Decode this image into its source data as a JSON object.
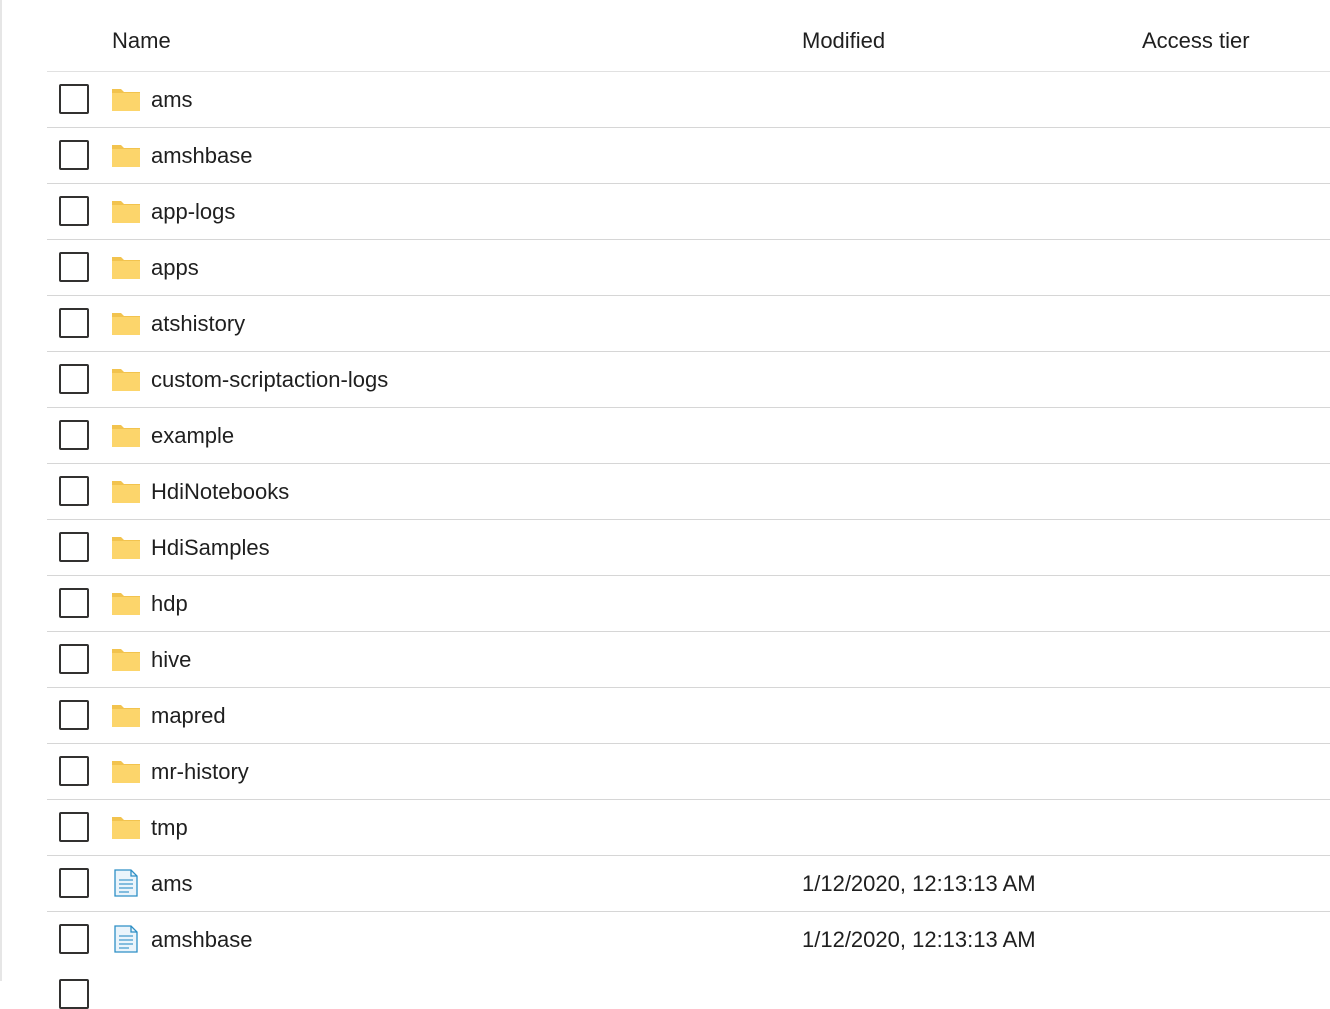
{
  "columns": {
    "name": "Name",
    "modified": "Modified",
    "access_tier": "Access tier"
  },
  "rows": [
    {
      "type": "folder",
      "icon": "folder-icon",
      "name": "ams",
      "modified": "",
      "access_tier": ""
    },
    {
      "type": "folder",
      "icon": "folder-icon",
      "name": "amshbase",
      "modified": "",
      "access_tier": ""
    },
    {
      "type": "folder",
      "icon": "folder-icon",
      "name": "app-logs",
      "modified": "",
      "access_tier": ""
    },
    {
      "type": "folder",
      "icon": "folder-icon",
      "name": "apps",
      "modified": "",
      "access_tier": ""
    },
    {
      "type": "folder",
      "icon": "folder-icon",
      "name": "atshistory",
      "modified": "",
      "access_tier": ""
    },
    {
      "type": "folder",
      "icon": "folder-icon",
      "name": "custom-scriptaction-logs",
      "modified": "",
      "access_tier": ""
    },
    {
      "type": "folder",
      "icon": "folder-icon",
      "name": "example",
      "modified": "",
      "access_tier": ""
    },
    {
      "type": "folder",
      "icon": "folder-icon",
      "name": "HdiNotebooks",
      "modified": "",
      "access_tier": ""
    },
    {
      "type": "folder",
      "icon": "folder-icon",
      "name": "HdiSamples",
      "modified": "",
      "access_tier": ""
    },
    {
      "type": "folder",
      "icon": "folder-icon",
      "name": "hdp",
      "modified": "",
      "access_tier": ""
    },
    {
      "type": "folder",
      "icon": "folder-icon",
      "name": "hive",
      "modified": "",
      "access_tier": ""
    },
    {
      "type": "folder",
      "icon": "folder-icon",
      "name": "mapred",
      "modified": "",
      "access_tier": ""
    },
    {
      "type": "folder",
      "icon": "folder-icon",
      "name": "mr-history",
      "modified": "",
      "access_tier": ""
    },
    {
      "type": "folder",
      "icon": "folder-icon",
      "name": "tmp",
      "modified": "",
      "access_tier": ""
    },
    {
      "type": "file",
      "icon": "file-icon",
      "name": "ams",
      "modified": "1/12/2020, 12:13:13 AM",
      "access_tier": ""
    },
    {
      "type": "file",
      "icon": "file-icon",
      "name": "amshbase",
      "modified": "1/12/2020, 12:13:13 AM",
      "access_tier": ""
    }
  ],
  "colors": {
    "folder_fill": "#fcd56b",
    "folder_tab": "#f2c34e",
    "file_stroke": "#2d8fc5",
    "row_border": "#d6d6d6"
  }
}
